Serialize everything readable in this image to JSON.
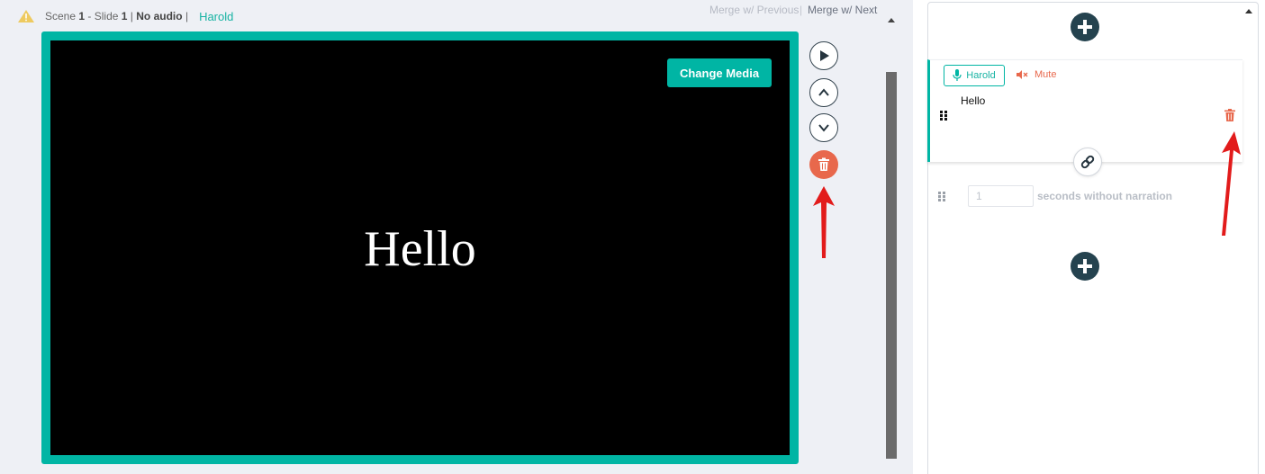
{
  "header": {
    "scene_label": "Scene",
    "scene_number": "1",
    "slide_label": "- Slide",
    "slide_number": "1",
    "separator": "|",
    "audio_status": "No audio",
    "voice_name": "Harold",
    "merge_previous": "Merge w/ Previous",
    "merge_divider": "|",
    "merge_next": "Merge w/ Next"
  },
  "slide": {
    "change_media_label": "Change Media",
    "text": "Hello"
  },
  "narration": {
    "voice_label": "Harold",
    "mute_label": "Mute",
    "text": "Hello"
  },
  "pause": {
    "value": "1",
    "label": "seconds without narration"
  },
  "colors": {
    "accent": "#00b5a4",
    "danger": "#e8684c",
    "dark": "#25434f",
    "annotation_arrow": "#e21b1b"
  }
}
